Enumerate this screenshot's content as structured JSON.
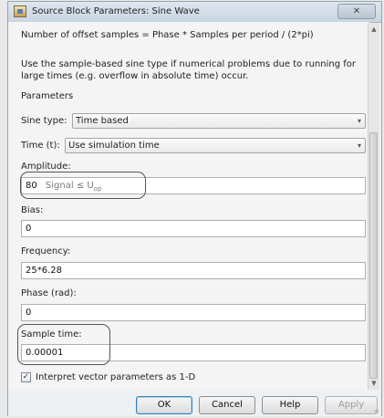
{
  "window": {
    "title": "Source Block Parameters: Sine Wave",
    "close_glyph": "✕"
  },
  "description": {
    "header": "Number of offset samples = Phase * Samples per period / (2*pi)",
    "body": "Use the sample-based sine type if numerical problems due to running for large times (e.g. overflow in absolute time) occur."
  },
  "parameters": {
    "section_label": "Parameters",
    "sine_type": {
      "label": "Sine type:",
      "value": "Time based"
    },
    "time": {
      "label": "Time (t):",
      "value": "Use simulation time"
    },
    "amplitude": {
      "label": "Amplitude:",
      "value": "80",
      "annotation": "Signal ≤ U",
      "annotation_sub": "op"
    },
    "bias": {
      "label": "Bias:",
      "value": "0"
    },
    "frequency": {
      "label": "Frequency:",
      "value": "25*6.28"
    },
    "phase": {
      "label": "Phase (rad):",
      "value": "0"
    },
    "sample_time": {
      "label": "Sample time:",
      "value": "0.00001"
    },
    "interpret_vector": {
      "label": "Interpret vector parameters as 1-D",
      "checked": true,
      "check_glyph": "✓"
    }
  },
  "buttons": {
    "ok": "OK",
    "cancel": "Cancel",
    "help": "Help",
    "apply": "Apply"
  },
  "icons": {
    "dropdown": "▾",
    "scroll_up": "▲",
    "scroll_down": "▼",
    "grip": "≡"
  },
  "colors": {
    "highlight_outline": "#555555",
    "ok_focus": "#3c7fb1"
  }
}
